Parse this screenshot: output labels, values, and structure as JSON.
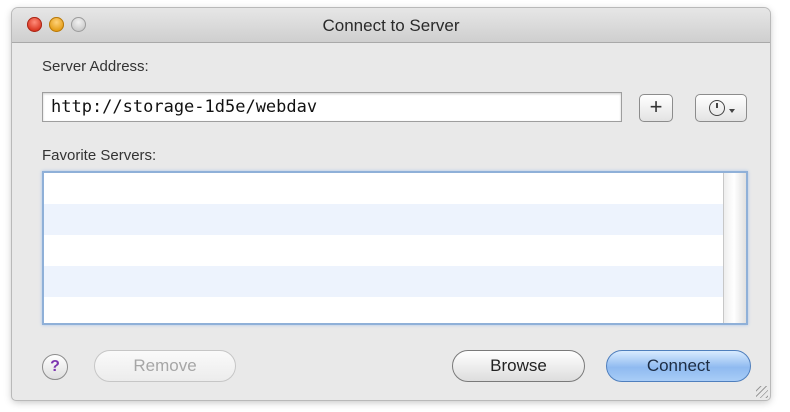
{
  "window": {
    "title": "Connect to Server"
  },
  "server_address": {
    "label": "Server Address:",
    "value": "http://storage-1d5e/webdav"
  },
  "toolbar": {
    "add_label": "+",
    "history_icon": "clock-icon"
  },
  "favorites": {
    "label": "Favorite Servers:",
    "items": []
  },
  "footer": {
    "help_label": "?",
    "remove_label": "Remove",
    "browse_label": "Browse",
    "connect_label": "Connect"
  },
  "colors": {
    "default_button": "#8fbaf0",
    "help_icon": "#7d35b0",
    "list_focus": "#8fb0d8"
  }
}
